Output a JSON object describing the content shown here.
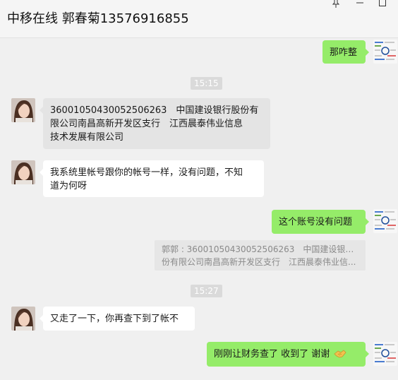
{
  "window": {
    "title": "中移在线 郭春菊13576916855"
  },
  "messages": {
    "m1": "那咋整",
    "t1": "15:15",
    "m2": "36001050430052506263　中国建设银行股份有\n限公司南昌高新开发区支行　江西晨泰伟业信息\n技术发展有限公司",
    "m3": "我系统里帐号跟你的帐号一样，没有问题，不知\n道为何呀",
    "m4": "这个账号没有问题",
    "quote_line1": "郭郭 : 36001050430052506263　中国建设银行股",
    "quote_line2": "份有限公司南昌高新开发区支行　江西晨泰伟业信...",
    "t2": "15:27",
    "m5": "又走了一下，你再查下到了帐不",
    "m6": "刚刚让财务查了  收到了  谢谢"
  },
  "colors": {
    "outgoing_bubble": "#95ec69",
    "incoming_bubble": "#ffffff",
    "background": "#f0f0f0"
  },
  "icons": {
    "pin": "pin-icon",
    "minimize": "minimize-icon",
    "maximize": "maximize-icon",
    "emoji": "handshake-emoji-icon"
  }
}
